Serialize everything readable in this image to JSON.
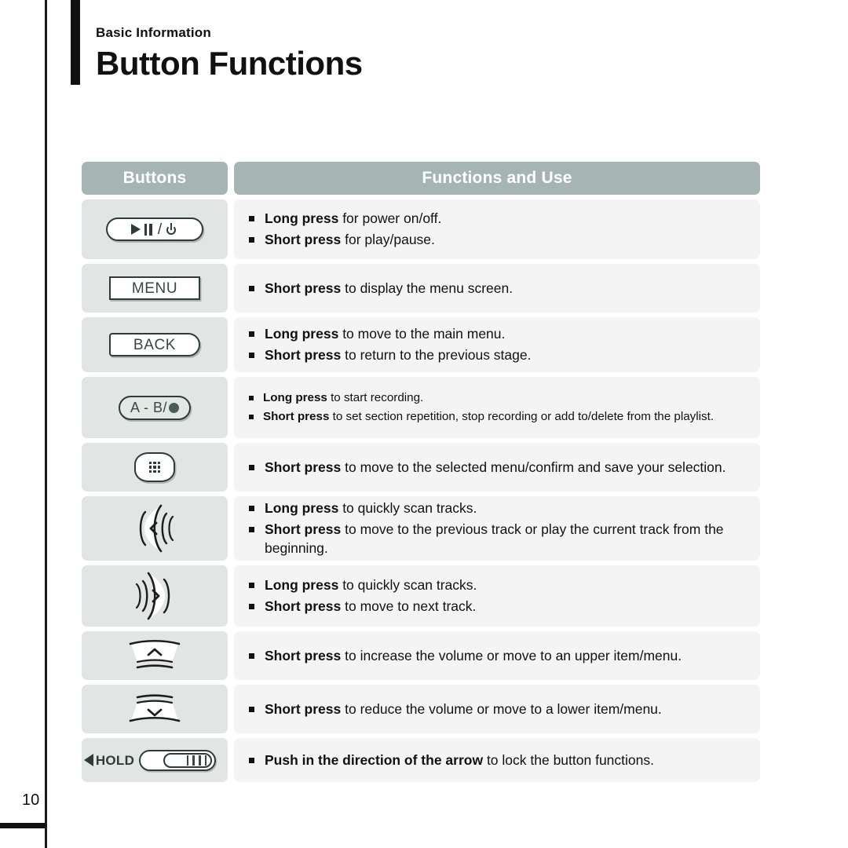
{
  "header": {
    "eyebrow": "Basic Information",
    "title": "Button Functions"
  },
  "table": {
    "columns": {
      "buttons": "Buttons",
      "functions": "Functions and Use"
    },
    "rows": [
      {
        "button": {
          "icon": "play-pause-power-button",
          "label": "",
          "slash": "/"
        },
        "lines": [
          {
            "strong": "Long press",
            "rest": " for power on/off."
          },
          {
            "strong": "Short press",
            "rest": " for play/pause."
          }
        ]
      },
      {
        "button": {
          "icon": "menu-button",
          "label": "MENU"
        },
        "lines": [
          {
            "strong": "Short press",
            "rest": " to display the menu screen."
          }
        ]
      },
      {
        "button": {
          "icon": "back-button",
          "label": "BACK"
        },
        "lines": [
          {
            "strong": "Long press",
            "rest": " to move to the main menu."
          },
          {
            "strong": "Short press",
            "rest": " to return to the previous stage."
          }
        ]
      },
      {
        "button": {
          "icon": "ab-record-button",
          "label": "A - B/"
        },
        "lines": [
          {
            "strong": "Long press",
            "rest": " to start recording."
          },
          {
            "strong": "Short press",
            "rest": " to set section repetition, stop recording or add to/delete from the playlist."
          }
        ]
      },
      {
        "button": {
          "icon": "select-grid-button",
          "label": ""
        },
        "lines": [
          {
            "strong": "Short press",
            "rest": " to move to the selected menu/confirm and save your selection."
          }
        ]
      },
      {
        "button": {
          "icon": "previous-track-button",
          "label": ""
        },
        "lines": [
          {
            "strong": "Long press",
            "rest": " to quickly scan tracks."
          },
          {
            "strong": "Short press",
            "rest": " to move to the previous track or play the current track from the beginning."
          }
        ]
      },
      {
        "button": {
          "icon": "next-track-button",
          "label": ""
        },
        "lines": [
          {
            "strong": "Long press",
            "rest": " to quickly scan tracks."
          },
          {
            "strong": "Short press",
            "rest": " to move to next track."
          }
        ]
      },
      {
        "button": {
          "icon": "volume-up-button",
          "label": ""
        },
        "lines": [
          {
            "strong": "Short press",
            "rest": " to increase the volume or move to an upper item/menu."
          }
        ]
      },
      {
        "button": {
          "icon": "volume-down-button",
          "label": ""
        },
        "lines": [
          {
            "strong": "Short press",
            "rest": " to reduce the volume or move to a lower item/menu."
          }
        ]
      },
      {
        "button": {
          "icon": "hold-switch",
          "label": "HOLD"
        },
        "lines": [
          {
            "strong": "Push in the direction of the arrow",
            "rest": " to lock the button functions."
          }
        ]
      }
    ]
  },
  "footer": {
    "page_number": "10"
  },
  "colors": {
    "header_bg": "#a6b5b4",
    "left_cell_bg": "#e1e5e3",
    "right_cell_bg": "#f3f4f3",
    "ink": "#2f3a39",
    "text": "#111111"
  }
}
